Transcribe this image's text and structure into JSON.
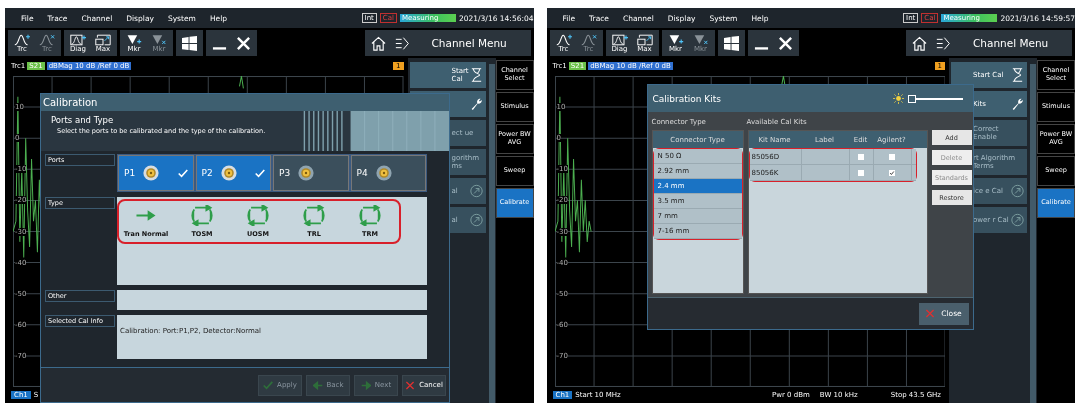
{
  "screens": [
    {
      "menu": [
        "File",
        "Trace",
        "Channel",
        "Display",
        "System",
        "Help"
      ],
      "status": {
        "int": "Int",
        "cal": "Cal",
        "measuring": "Measuring",
        "datetime": "2021/3/16 14:56:04"
      },
      "toolbar": [
        {
          "label": "Trc",
          "kind": "trace_add",
          "disabled": false
        },
        {
          "label": "Trc",
          "kind": "trace_delete",
          "disabled": true
        },
        {
          "label": "Diag",
          "kind": "diagram",
          "disabled": false
        },
        {
          "label": "Max",
          "kind": "maximize",
          "disabled": false
        },
        {
          "label": "Mkr",
          "kind": "marker_add",
          "disabled": false
        },
        {
          "label": "Mkr",
          "kind": "marker_delete",
          "disabled": true
        }
      ],
      "panel_title": "Channel Menu",
      "trace": {
        "name": "Trc1",
        "param": "S21",
        "scale": "dBMag 10 dB /Ref 0 dB",
        "marker": "1"
      },
      "y_labels": [
        "10",
        "0",
        "-10",
        "-20",
        "-30",
        "-40",
        "-50",
        "-60",
        "-70"
      ],
      "softkeys": [
        {
          "label": "Start Cal",
          "kind": "hourglass",
          "disabled": false
        },
        {
          "kind": "wrench",
          "disabled": false
        },
        {
          "label": "ect ue",
          "kind": "none",
          "disabled": true
        },
        {
          "label": "gorithm ms",
          "kind": "none",
          "disabled": true
        },
        {
          "label": "al",
          "kind": "arrow",
          "disabled": true
        },
        {
          "label": "al",
          "kind": "arrow",
          "disabled": true
        }
      ],
      "side_menu": [
        {
          "label": "Channel Select",
          "selected": false
        },
        {
          "label": "Stimulus",
          "selected": false
        },
        {
          "label": "Power BW AVG",
          "selected": false
        },
        {
          "label": "Sweep",
          "selected": false
        },
        {
          "label": "Calibrate",
          "selected": true
        }
      ],
      "footer": {
        "channel": "Ch1",
        "start": "S"
      },
      "dialog": {
        "kind": "calibration",
        "title": "Calibration",
        "step": "Ports and Type",
        "hint": "Select the ports to be calibrated and the type of the calibration.",
        "ports_label": "Ports",
        "ports": [
          {
            "label": "P1",
            "selected": true
          },
          {
            "label": "P2",
            "selected": true
          },
          {
            "label": "P3",
            "selected": false
          },
          {
            "label": "P4",
            "selected": false
          }
        ],
        "type_label": "Type",
        "types": [
          {
            "label": "Tran Normal",
            "kind": "arrow"
          },
          {
            "label": "TOSM",
            "kind": "loop"
          },
          {
            "label": "UOSM",
            "kind": "loop"
          },
          {
            "label": "TRL",
            "kind": "loop"
          },
          {
            "label": "TRM",
            "kind": "loop"
          }
        ],
        "other_label": "Other",
        "info_label": "Selected Cal Info",
        "info": "Calibration: Port:P1,P2, Detector:Normal",
        "buttons": [
          {
            "label": "Apply",
            "kind": "apply",
            "disabled": true
          },
          {
            "label": "Back",
            "kind": "back",
            "disabled": true
          },
          {
            "label": "Next",
            "kind": "next",
            "disabled": true
          },
          {
            "label": "Cancel",
            "kind": "cancel",
            "disabled": false
          }
        ]
      }
    },
    {
      "menu": [
        "File",
        "Trace",
        "Channel",
        "Display",
        "System",
        "Help"
      ],
      "status": {
        "int": "Int",
        "cal": "Cal",
        "measuring": "Measuring",
        "datetime": "2021/3/16 14:59:57"
      },
      "toolbar": [
        {
          "label": "Trc",
          "kind": "trace_add",
          "disabled": false
        },
        {
          "label": "Trc",
          "kind": "trace_delete",
          "disabled": true
        },
        {
          "label": "Diag",
          "kind": "diagram",
          "disabled": false
        },
        {
          "label": "Max",
          "kind": "maximize",
          "disabled": false
        },
        {
          "label": "Mkr",
          "kind": "marker_add",
          "disabled": false
        },
        {
          "label": "Mkr",
          "kind": "marker_delete",
          "disabled": true
        }
      ],
      "panel_title": "Channel Menu",
      "trace": {
        "name": "Trc1",
        "param": "S21",
        "scale": "dBMag 10 dB /Ref 0 dB",
        "marker": "1"
      },
      "y_labels": [
        "10",
        "0",
        "-10",
        "-20",
        "-30",
        "-40",
        "-50",
        "-60",
        "-70"
      ],
      "softkeys": [
        {
          "label": "Start Cal",
          "kind": "hourglass",
          "disabled": false
        },
        {
          "label": "Kits",
          "kind": "wrench",
          "disabled": false
        },
        {
          "label": "Correct Enable",
          "kind": "none",
          "disabled": true
        },
        {
          "label": "rt Algorithm Terms",
          "kind": "none",
          "disabled": true
        },
        {
          "label": "ice e Cal",
          "kind": "arrow",
          "disabled": true
        },
        {
          "label": "ower r Cal",
          "kind": "arrow",
          "disabled": true
        }
      ],
      "side_menu": [
        {
          "label": "Channel Select",
          "selected": false
        },
        {
          "label": "Stimulus",
          "selected": false
        },
        {
          "label": "Power BW AVG",
          "selected": false
        },
        {
          "label": "Sweep",
          "selected": false
        },
        {
          "label": "Calibrate",
          "selected": true
        }
      ],
      "footer": {
        "channel": "Ch1",
        "start": "Start 10 MHz",
        "middle": [
          "Pwr 0 dBm",
          "BW 10 kHz"
        ],
        "stop": "Stop 43.5 GHz"
      },
      "dialog": {
        "kind": "cal_kits",
        "title": "Calibration Kits",
        "brightness": {
          "level": 0
        },
        "connector_heading": "Connector Type",
        "kits_heading": "Available Cal Kits",
        "connector_column": "Connector Type",
        "connectors": [
          {
            "label": "N 50 Ω",
            "selected": false
          },
          {
            "label": "2.92 mm",
            "selected": false
          },
          {
            "label": "2.4 mm",
            "selected": true
          },
          {
            "label": "3.5 mm",
            "selected": false
          },
          {
            "label": "7 mm",
            "selected": false
          },
          {
            "label": "7-16 mm",
            "selected": false
          }
        ],
        "kit_columns": [
          "Kit Name",
          "Label",
          "Edit",
          "Agilent?"
        ],
        "kits": [
          {
            "name": "85056D",
            "edit": false,
            "agilent": false
          },
          {
            "name": "85056K",
            "edit": false,
            "agilent": true
          }
        ],
        "buttons": [
          {
            "label": "Add",
            "disabled": false
          },
          {
            "label": "Delete",
            "disabled": true
          },
          {
            "label": "Standards",
            "disabled": true
          },
          {
            "label": "Restore",
            "disabled": false
          }
        ],
        "close": "Close"
      }
    }
  ]
}
